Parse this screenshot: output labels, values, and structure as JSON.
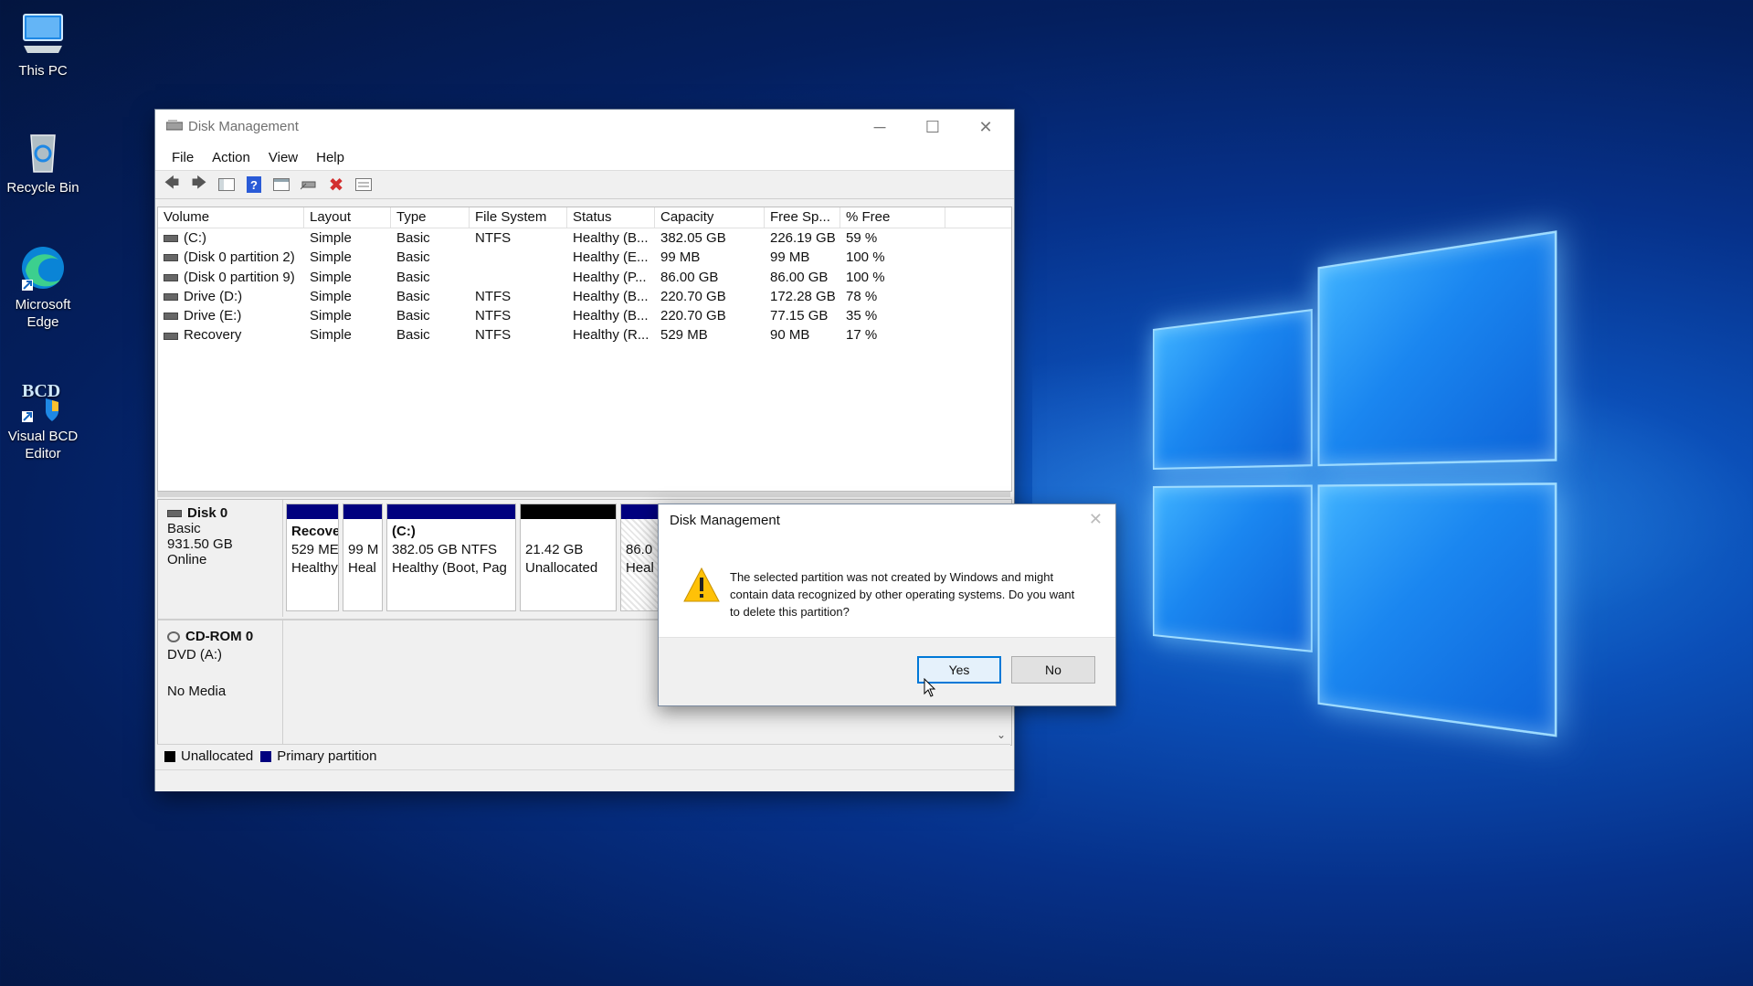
{
  "desktop": {
    "icons": [
      {
        "label": "This PC"
      },
      {
        "label": "Recycle Bin"
      },
      {
        "label": "Microsoft Edge"
      },
      {
        "label": "Visual BCD Editor"
      }
    ]
  },
  "window": {
    "title": "Disk Management",
    "menu": [
      "File",
      "Action",
      "View",
      "Help"
    ],
    "columns": [
      "Volume",
      "Layout",
      "Type",
      "File System",
      "Status",
      "Capacity",
      "Free Sp...",
      "% Free"
    ],
    "rows": [
      [
        "(C:)",
        "Simple",
        "Basic",
        "NTFS",
        "Healthy (B...",
        "382.05 GB",
        "226.19 GB",
        "59 %"
      ],
      [
        "(Disk 0 partition 2)",
        "Simple",
        "Basic",
        "",
        "Healthy (E...",
        "99 MB",
        "99 MB",
        "100 %"
      ],
      [
        "(Disk 0 partition 9)",
        "Simple",
        "Basic",
        "",
        "Healthy (P...",
        "86.00 GB",
        "86.00 GB",
        "100 %"
      ],
      [
        "Drive (D:)",
        "Simple",
        "Basic",
        "NTFS",
        "Healthy (B...",
        "220.70 GB",
        "172.28 GB",
        "78 %"
      ],
      [
        "Drive (E:)",
        "Simple",
        "Basic",
        "NTFS",
        "Healthy (B...",
        "220.70 GB",
        "77.15 GB",
        "35 %"
      ],
      [
        "Recovery",
        "Simple",
        "Basic",
        "NTFS",
        "Healthy (R...",
        "529 MB",
        "90 MB",
        "17 %"
      ]
    ],
    "disk0": {
      "name": "Disk 0",
      "type": "Basic",
      "size": "931.50 GB",
      "state": "Online",
      "partitions": [
        {
          "l1": "Recove",
          "l2": "529 ME",
          "l3": "Healthy",
          "color": "#00007f"
        },
        {
          "l1": "",
          "l2": "99 M",
          "l3": "Heal",
          "color": "#00007f"
        },
        {
          "l1": "(C:)",
          "l2": "382.05 GB NTFS",
          "l3": "Healthy (Boot, Pag",
          "color": "#00007f"
        },
        {
          "l1": "",
          "l2": "21.42 GB",
          "l3": "Unallocated",
          "color": "#000000"
        },
        {
          "l1": "",
          "l2": "86.0",
          "l3": "Heal",
          "color": "#00007f"
        }
      ]
    },
    "cdrom": {
      "name": "CD-ROM 0",
      "type": "DVD (A:)",
      "state": "No Media"
    },
    "legend": {
      "unallocated": "Unallocated",
      "primary": "Primary partition",
      "unallocated_color": "#000000",
      "primary_color": "#00007f"
    }
  },
  "dialog": {
    "title": "Disk Management",
    "message": "The selected partition was not created by Windows and might contain data recognized by other operating systems. Do you want to delete this partition?",
    "yes": "Yes",
    "no": "No"
  }
}
